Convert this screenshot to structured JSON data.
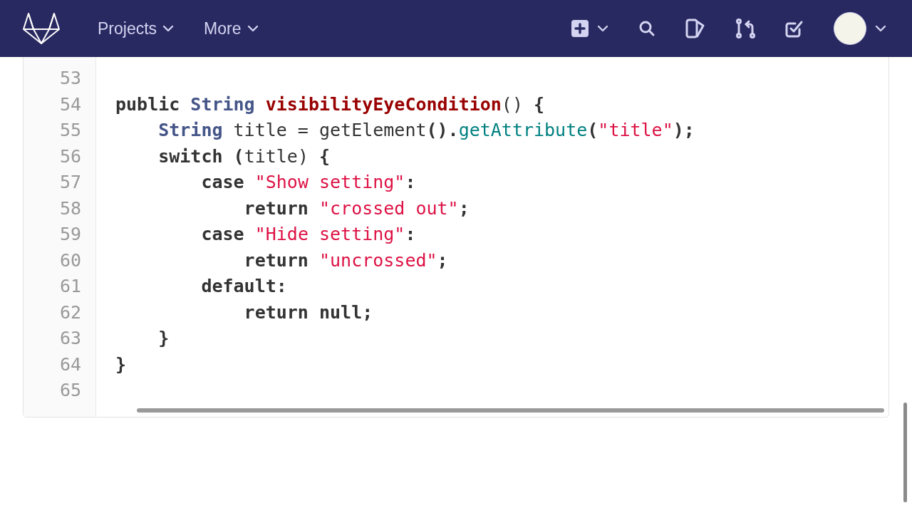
{
  "nav": {
    "items": [
      {
        "label": "Projects"
      },
      {
        "label": "More"
      }
    ]
  },
  "code": {
    "lines": [
      {
        "number": "53"
      },
      {
        "number": "54",
        "tokens": [
          {
            "text": "public ",
            "kind": "keyword"
          },
          {
            "text": "String ",
            "kind": "type"
          },
          {
            "text": "visibilityEyeCondition",
            "kind": "function"
          },
          {
            "text": "() ",
            "kind": "plain"
          },
          {
            "text": "{",
            "kind": "keyword"
          }
        ]
      },
      {
        "number": "55",
        "tokens": [
          {
            "text": "    String",
            "kind": "type"
          },
          {
            "text": " title = getElement",
            "kind": "plain"
          },
          {
            "text": "().",
            "kind": "keyword"
          },
          {
            "text": "getAttribute",
            "kind": "call"
          },
          {
            "text": "(",
            "kind": "keyword"
          },
          {
            "text": "\"title\"",
            "kind": "string"
          },
          {
            "text": ");",
            "kind": "keyword"
          }
        ]
      },
      {
        "number": "56",
        "tokens": [
          {
            "text": "    switch (",
            "kind": "keyword"
          },
          {
            "text": "title) ",
            "kind": "plain"
          },
          {
            "text": "{",
            "kind": "keyword"
          }
        ]
      },
      {
        "number": "57",
        "tokens": [
          {
            "text": "        case ",
            "kind": "keyword"
          },
          {
            "text": "\"Show setting\"",
            "kind": "string"
          },
          {
            "text": ":",
            "kind": "keyword"
          }
        ]
      },
      {
        "number": "58",
        "tokens": [
          {
            "text": "            return ",
            "kind": "keyword"
          },
          {
            "text": "\"crossed out\"",
            "kind": "string"
          },
          {
            "text": ";",
            "kind": "keyword"
          }
        ]
      },
      {
        "number": "59",
        "tokens": [
          {
            "text": "        case ",
            "kind": "keyword"
          },
          {
            "text": "\"Hide setting\"",
            "kind": "string"
          },
          {
            "text": ":",
            "kind": "keyword"
          }
        ]
      },
      {
        "number": "60",
        "tokens": [
          {
            "text": "            return ",
            "kind": "keyword"
          },
          {
            "text": "\"uncrossed\"",
            "kind": "string"
          },
          {
            "text": ";",
            "kind": "keyword"
          }
        ]
      },
      {
        "number": "61",
        "tokens": [
          {
            "text": "        default:",
            "kind": "keyword"
          }
        ]
      },
      {
        "number": "62",
        "tokens": [
          {
            "text": "            return null;",
            "kind": "keyword"
          }
        ]
      },
      {
        "number": "63",
        "tokens": [
          {
            "text": "    }",
            "kind": "keyword"
          }
        ]
      },
      {
        "number": "64",
        "tokens": [
          {
            "text": "}",
            "kind": "keyword"
          }
        ]
      },
      {
        "number": "65"
      }
    ]
  }
}
